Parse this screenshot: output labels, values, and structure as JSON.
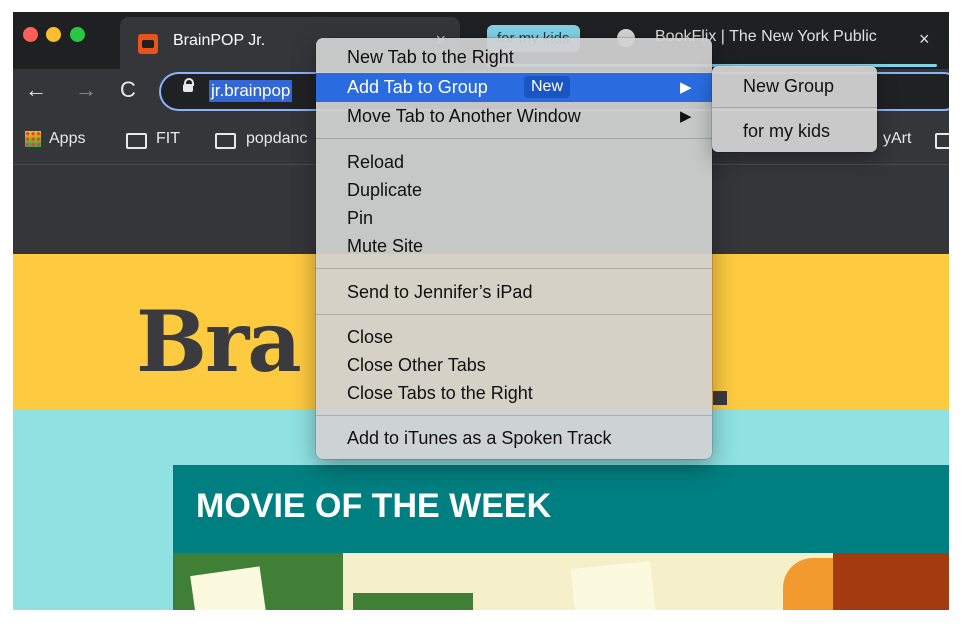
{
  "tabs": {
    "active": {
      "title": "BrainPOP Jr.",
      "close": "×"
    },
    "group_chip": "for my kids",
    "second": {
      "title": "BookFlix | The New York Public",
      "close": "×"
    }
  },
  "toolbar": {
    "back": "←",
    "forward": "→",
    "reload": "C",
    "url": "jr.brainpop"
  },
  "bookmarks": [
    {
      "label": "Apps"
    },
    {
      "label": "FIT"
    },
    {
      "label": "popdanc"
    },
    {
      "label": "yArt"
    }
  ],
  "page": {
    "logo": "Bra",
    "movie_title": "MOVIE OF THE WEEK"
  },
  "context_menu": {
    "items": [
      {
        "label": "New Tab to the Right"
      },
      {
        "label": "Add Tab to Group",
        "badge": "New",
        "arrow": "▶"
      },
      {
        "label": "Move Tab to Another Window",
        "arrow": "▶"
      },
      {
        "label": "Reload"
      },
      {
        "label": "Duplicate"
      },
      {
        "label": "Pin"
      },
      {
        "label": "Mute Site"
      },
      {
        "label": "Send to Jennifer’s iPad"
      },
      {
        "label": "Close"
      },
      {
        "label": "Close Other Tabs"
      },
      {
        "label": "Close Tabs to the Right"
      },
      {
        "label": "Add to iTunes as a Spoken Track"
      }
    ]
  },
  "submenu": {
    "items": [
      {
        "label": "New Group"
      },
      {
        "label": "for my kids"
      }
    ]
  },
  "colors": {
    "highlight": "#2a6ce0",
    "group": "#7fd4ea",
    "brand_yellow": "#fdca40",
    "brand_teal": "#007f80"
  }
}
